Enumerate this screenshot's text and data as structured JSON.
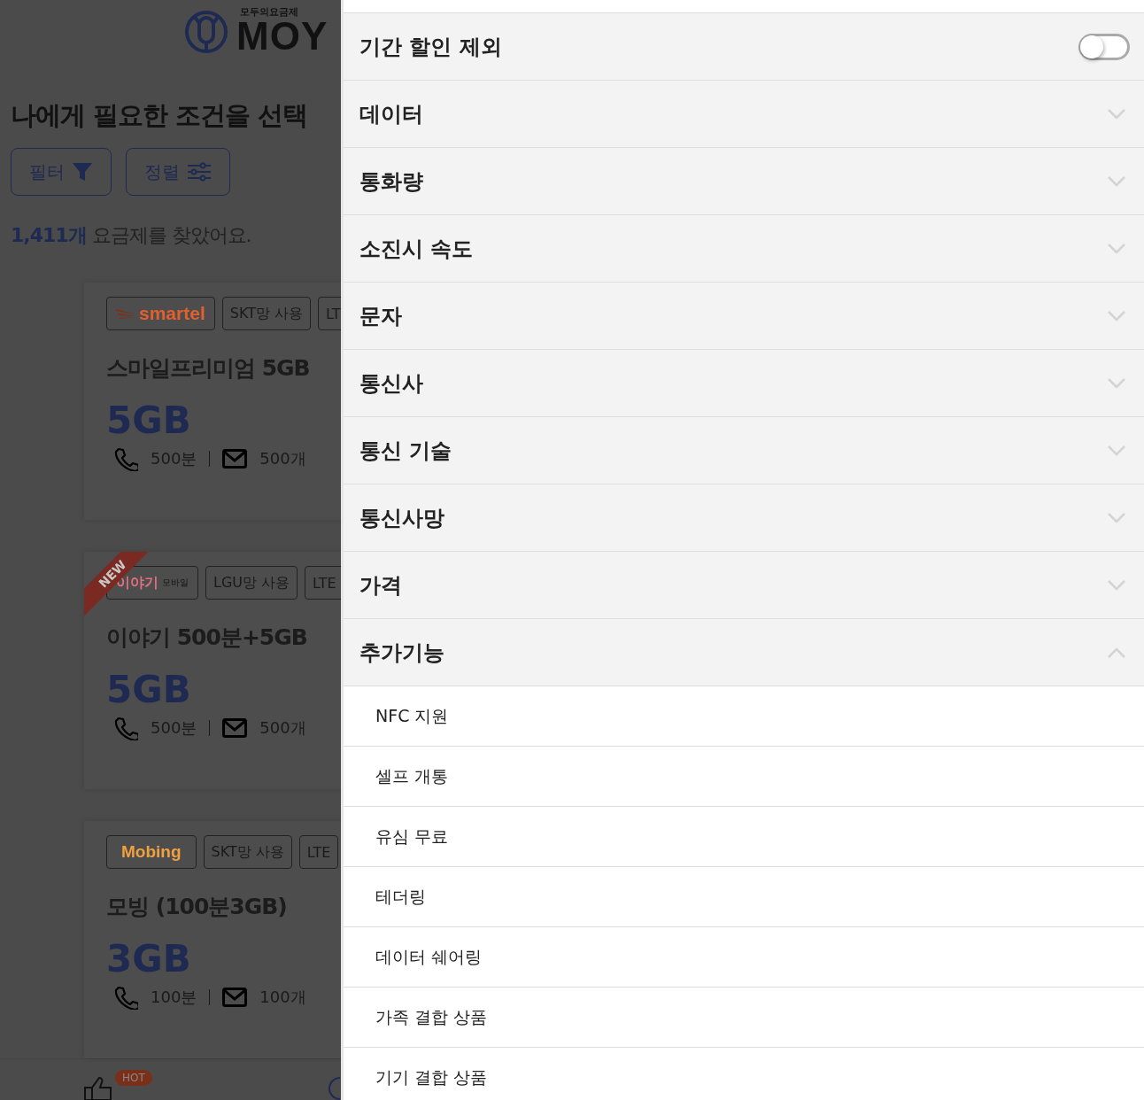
{
  "page": {
    "logo": {
      "tagline": "모두의요금제",
      "wordmark": "MOY"
    },
    "heading": "나에게 필요한 조건을 선택",
    "buttons": [
      {
        "kind": "filter",
        "label": "필터"
      },
      {
        "kind": "sort",
        "label": "정렬"
      }
    ],
    "result": {
      "count": "1,411개",
      "text": "요금제를 찾았어요."
    },
    "plans": [
      {
        "carrier": {
          "kind": "smartel",
          "name": "smartel"
        },
        "new": false,
        "tags": [
          "SKT망 사용",
          "LT"
        ],
        "name": "스마일프리미엄 5GB",
        "data": "5GB",
        "calls": "500분",
        "texts": "500개"
      },
      {
        "carrier": {
          "kind": "iyagi",
          "name": "이야기",
          "sub": "모바일"
        },
        "new": true,
        "new_label": "NEW",
        "tags": [
          "LGU망 사용",
          "LTE"
        ],
        "name": "이야기 500분+5GB",
        "data": "5GB",
        "calls": "500분",
        "texts": "500개"
      },
      {
        "carrier": {
          "kind": "mobing",
          "name": "Mobing"
        },
        "new": false,
        "tags": [
          "SKT망 사용",
          "LTE"
        ],
        "name": "모빙 (100분3GB)",
        "data": "3GB",
        "calls": "100분",
        "texts": "100개"
      }
    ],
    "bottom_nav": {
      "badge": "HOT"
    }
  },
  "drawer": {
    "toggle": {
      "label": "기간 할인 제외",
      "on": false
    },
    "sections": [
      {
        "label": "데이터",
        "expanded": false
      },
      {
        "label": "통화량",
        "expanded": false
      },
      {
        "label": "소진시 속도",
        "expanded": false
      },
      {
        "label": "문자",
        "expanded": false
      },
      {
        "label": "통신사",
        "expanded": false
      },
      {
        "label": "통신 기술",
        "expanded": false
      },
      {
        "label": "통신사망",
        "expanded": false
      },
      {
        "label": "가격",
        "expanded": false
      },
      {
        "label": "추가기능",
        "expanded": true,
        "options": [
          "NFC 지원",
          "셀프 개통",
          "유심 무료",
          "테더링",
          "데이터 쉐어링",
          "가족 결합 상품",
          "기기 결합 상품"
        ]
      }
    ]
  }
}
